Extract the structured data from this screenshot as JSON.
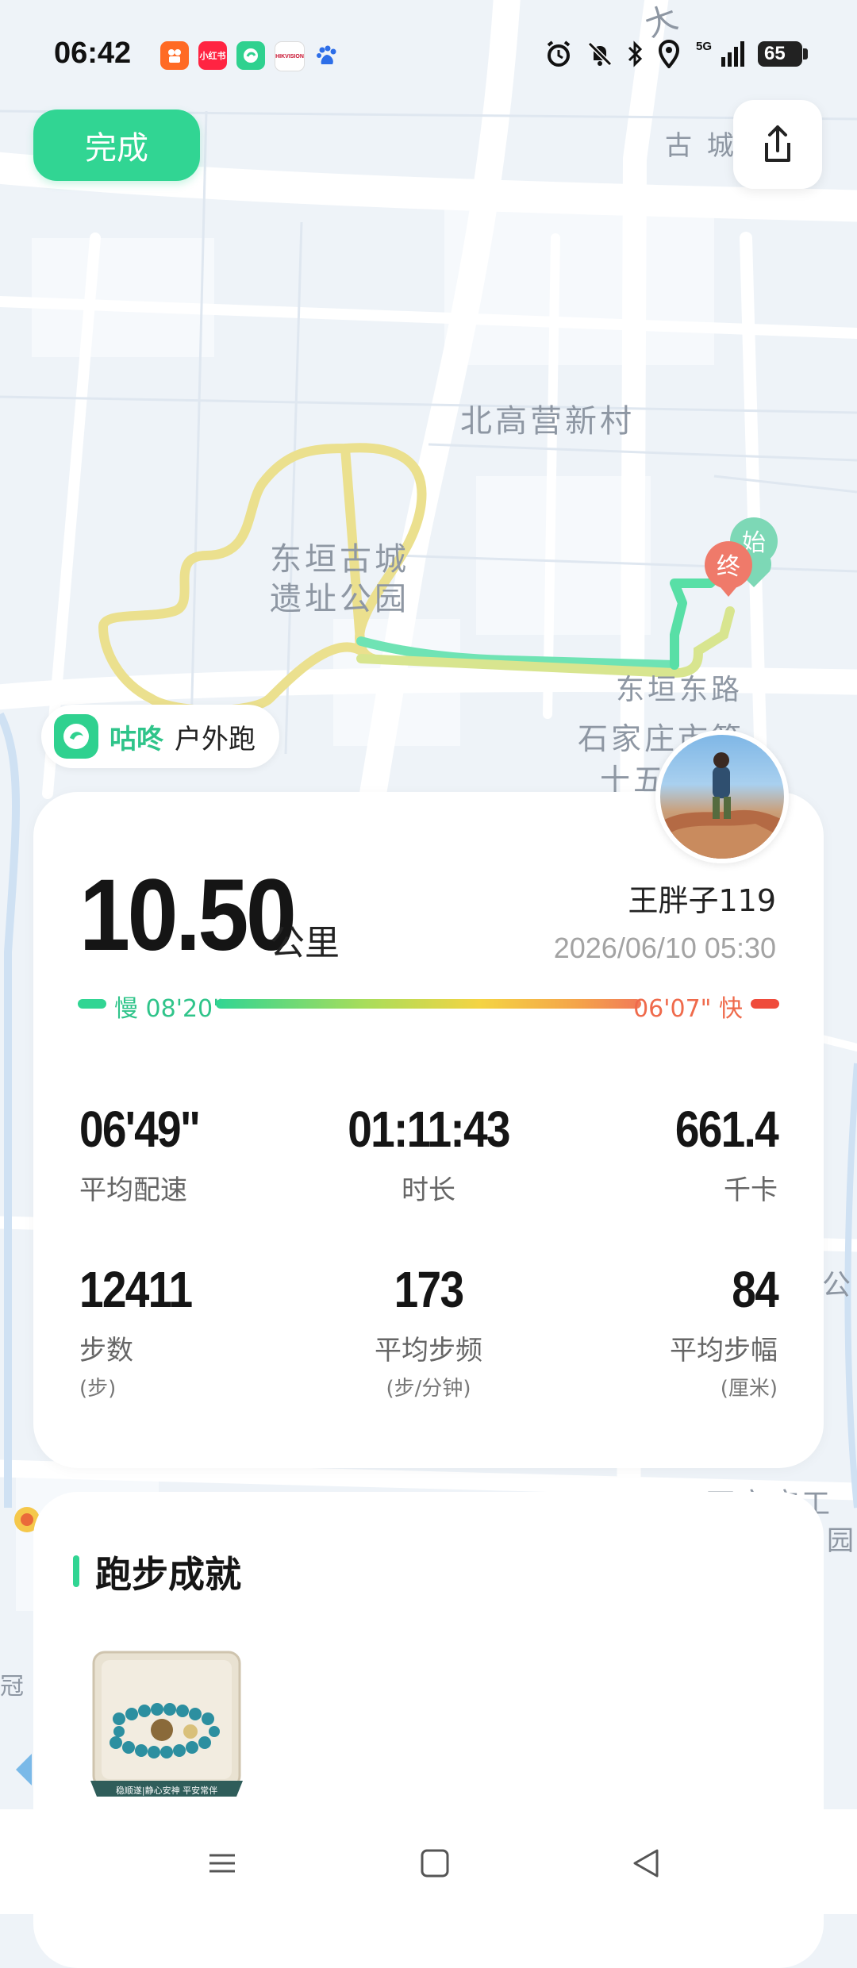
{
  "status_bar": {
    "time": "06:42",
    "battery": "65",
    "network": "5G",
    "app_icons": [
      "kuaishou-icon",
      "xiaohongshu-icon",
      "gudong-icon",
      "hikvision-icon",
      "baidu-icon"
    ],
    "app_icon_labels": {
      "xiaohongshu": "小红书",
      "hikvision": "HIKVISION"
    }
  },
  "header": {
    "done_label": "完成",
    "share_icon": "share-icon"
  },
  "map": {
    "labels": [
      "古 城",
      "北高营新村",
      "东垣古城",
      "遗址公园",
      "东垣东路",
      "石家庄市第",
      "十五",
      "石家庄工",
      "公园",
      "冠",
      "公",
      "大"
    ],
    "start_marker": "始",
    "end_marker": "终",
    "route_colors": {
      "slow": "#31d593",
      "mid": "#e8e08a",
      "fast": "#f4d443"
    }
  },
  "brand": {
    "name": "咕咚",
    "sport": "户外跑"
  },
  "summary": {
    "distance": "10.50",
    "distance_unit": "公里",
    "user_name": "王胖子119",
    "date": "2026/06/10 05:30",
    "pace_slow_label": "慢 08'20\"",
    "pace_fast_label": "06'07\" 快"
  },
  "stats": [
    {
      "value": "06'49\"",
      "label": "平均配速",
      "unit": ""
    },
    {
      "value": "01:11:43",
      "label": "时长",
      "unit": ""
    },
    {
      "value": "661.4",
      "label": "千卡",
      "unit": ""
    },
    {
      "value": "12411",
      "label": "步数",
      "unit": "(步)"
    },
    {
      "value": "173",
      "label": "平均步频",
      "unit": "(步/分钟)"
    },
    {
      "value": "84",
      "label": "平均步幅",
      "unit": "(厘米)"
    }
  ],
  "achievements": {
    "title": "跑步成就",
    "medal_caption": "稳顺遂|静心安神 平安常伴"
  },
  "colors": {
    "accent": "#31d593",
    "fast": "#ef4b3b"
  }
}
